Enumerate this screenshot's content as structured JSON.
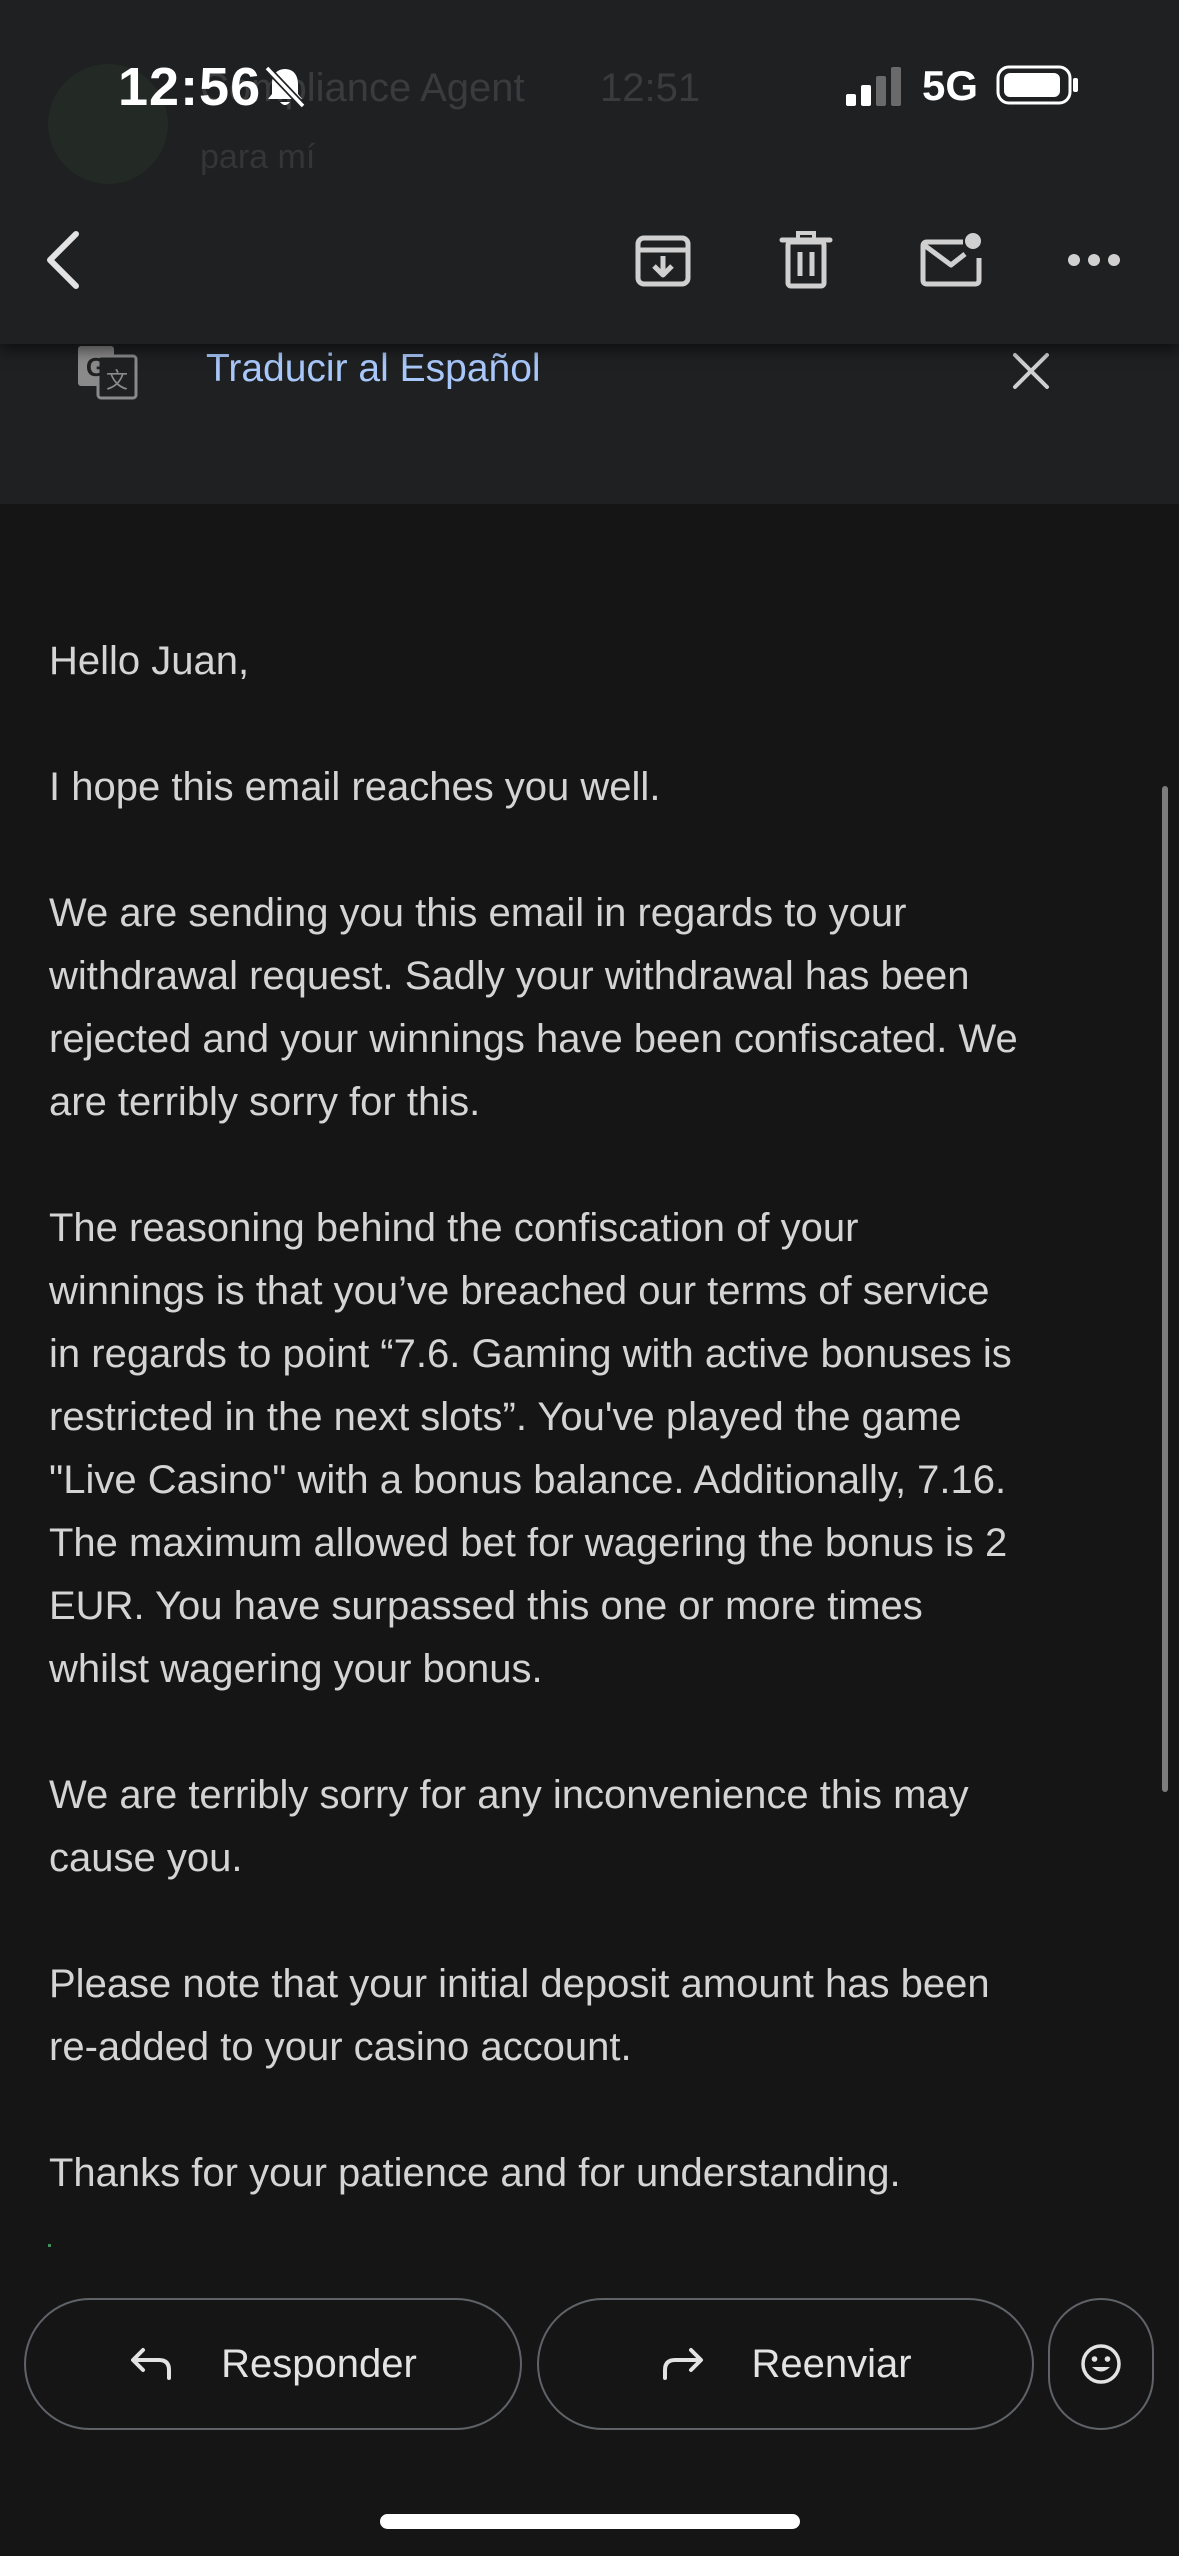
{
  "status_bar": {
    "time": "12:56",
    "network": "5G"
  },
  "header": {
    "sender_ghost": "Compliance Agent",
    "sender_time_ghost": "12:51",
    "to_ghost": "para mí"
  },
  "toolbar": {
    "back_icon": "back-arrow-icon",
    "archive_icon": "archive-icon",
    "delete_icon": "trash-icon",
    "mark_unread_icon": "mail-unread-icon",
    "more_icon": "more-dots-icon"
  },
  "translate": {
    "label": "Traducir al Español",
    "icon": "google-translate-icon",
    "close_icon": "close-icon",
    "link_color": "#a8c7fa"
  },
  "email": {
    "paragraphs": [
      "Hello Juan,",
      "I hope this email reaches you well.",
      "We are sending you this email in regards to your\nwithdrawal request. Sadly your withdrawal has been\nrejected and your winnings have been confiscated. We\nare terribly sorry for this.",
      "The reasoning behind the confiscation of your\nwinnings is that you’ve breached our terms of service\nin regards to point “7.6. Gaming with active bonuses is\nrestricted in the next slots”. You've played the game\n\"Live Casino\" with a bonus balance. Additionally, 7.16.\nThe maximum allowed bet for wagering the bonus is 2\nEUR. You have surpassed this one or more times\nwhilst wagering your bonus.",
      "We are terribly sorry for any inconvenience this may\ncause you.",
      "Please note that your initial deposit amount has been\nre-added to your casino account.",
      "Thanks for your patience and for understanding."
    ]
  },
  "actions": {
    "reply_label": "Responder",
    "forward_label": "Reenviar",
    "reply_icon": "reply-arrow-icon",
    "forward_icon": "forward-arrow-icon",
    "emoji_icon": "emoji-reaction-icon"
  },
  "colors": {
    "background": "#151515",
    "toolbar_bg": "#1f2022",
    "text": "#d4d4d4",
    "accent": "#a8c7fa"
  }
}
